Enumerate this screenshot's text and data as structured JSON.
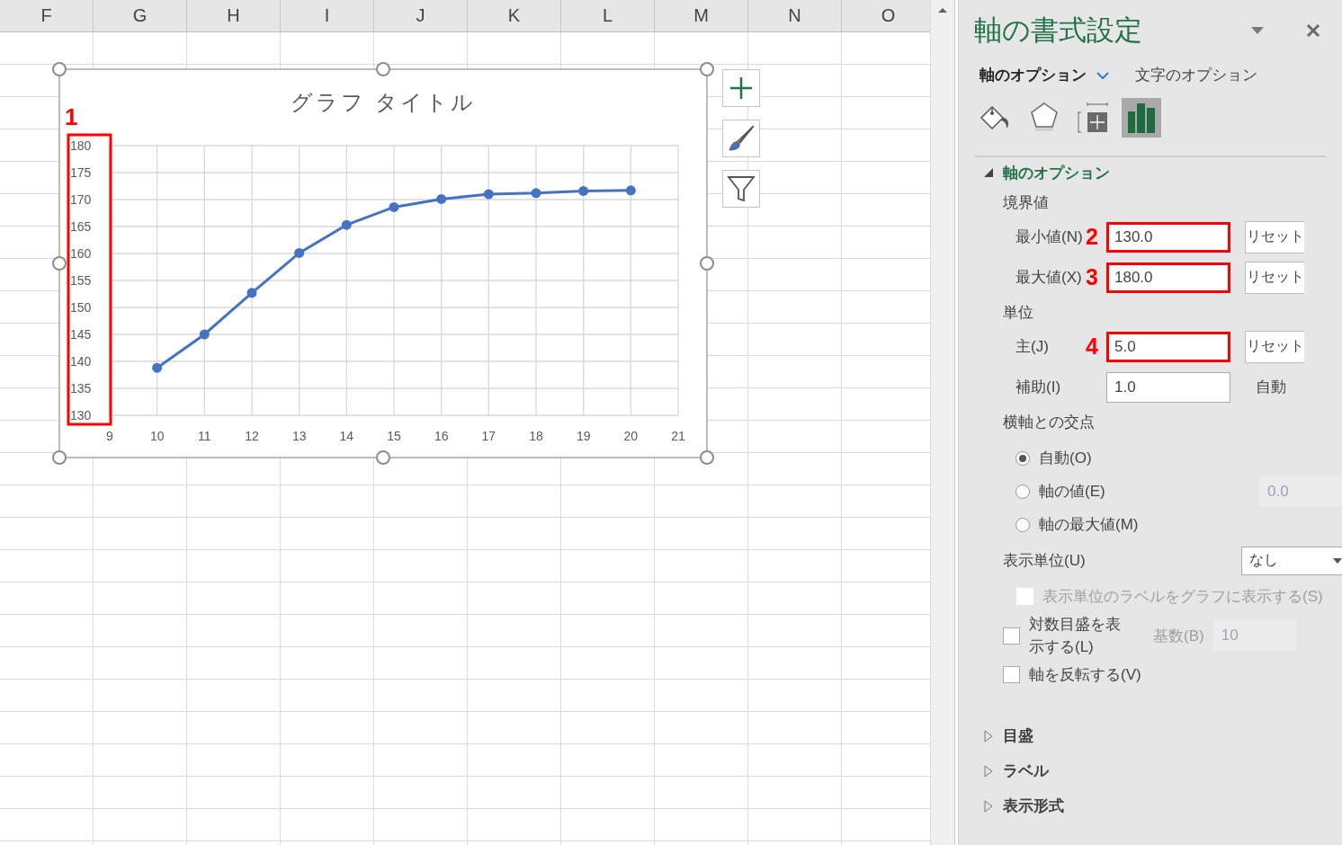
{
  "sheet": {
    "columns": [
      "F",
      "G",
      "H",
      "I",
      "J",
      "K",
      "L",
      "M",
      "N",
      "O"
    ]
  },
  "chart": {
    "annotation": "1",
    "chart_data": {
      "type": "line",
      "title": "グラフ タイトル",
      "x": [
        10,
        11,
        12,
        13,
        14,
        15,
        16,
        17,
        18,
        19,
        20
      ],
      "grid": true,
      "series": [
        {
          "color": "#4472c4",
          "marker": true,
          "values": [
            138.8,
            145,
            152.7,
            160.1,
            165.3,
            168.6,
            170.1,
            171,
            171.2,
            171.6,
            171.7
          ]
        }
      ],
      "xlim": [
        9,
        21
      ],
      "ylim": [
        130,
        180
      ],
      "xticks": [
        9,
        10,
        11,
        12,
        13,
        14,
        15,
        16,
        17,
        18,
        19,
        20,
        21
      ],
      "yticks": [
        130,
        135,
        140,
        145,
        150,
        155,
        160,
        165,
        170,
        175,
        180
      ]
    }
  },
  "panel": {
    "title": "軸の書式設定",
    "tabs": [
      {
        "label": "軸のオプション",
        "selected": true
      },
      {
        "label": "文字のオプション",
        "selected": false
      }
    ],
    "icon_tabs": [
      {
        "kind": "fill",
        "selected": false
      },
      {
        "kind": "effects",
        "selected": false
      },
      {
        "kind": "size",
        "selected": false
      },
      {
        "kind": "options",
        "selected": true
      }
    ],
    "section": {
      "title": "軸のオプション",
      "expanded": true
    },
    "bounds_label": "境界値",
    "bounds": [
      {
        "label": "最小値(N)",
        "annotation": "2",
        "value": "130.0",
        "highlighted": true,
        "button": "リセット"
      },
      {
        "label": "最大値(X)",
        "annotation": "3",
        "value": "180.0",
        "highlighted": true,
        "button": "リセット"
      }
    ],
    "units_label": "単位",
    "units": [
      {
        "label": "主(J)",
        "annotation": "4",
        "value": "5.0",
        "highlighted": true,
        "button": "リセット"
      },
      {
        "label": "補助(I)",
        "value": "1.0",
        "highlighted": false,
        "status": "自動"
      }
    ],
    "crossing_label": "横軸との交点",
    "crossing": [
      {
        "label": "自動(O)",
        "selected": true
      },
      {
        "label": "軸の値(E)",
        "selected": false,
        "value": "0.0"
      },
      {
        "label": "軸の最大値(M)",
        "selected": false
      }
    ],
    "display_unit": {
      "label": "表示単位(U)",
      "value": "なし"
    },
    "checkboxes": [
      {
        "label": "表示単位のラベルをグラフに表示する(S)",
        "checked": false,
        "disabled": true
      },
      {
        "label": "対数目盛を表示する(L)",
        "checked": false,
        "disabled": false,
        "base_label": "基数(B)",
        "base_value": "10"
      },
      {
        "label": "軸を反転する(V)",
        "checked": false,
        "disabled": false
      }
    ],
    "sections": [
      {
        "title": "目盛",
        "expanded": false
      },
      {
        "title": "ラベル",
        "expanded": false
      },
      {
        "title": "表示形式",
        "expanded": false
      }
    ]
  }
}
